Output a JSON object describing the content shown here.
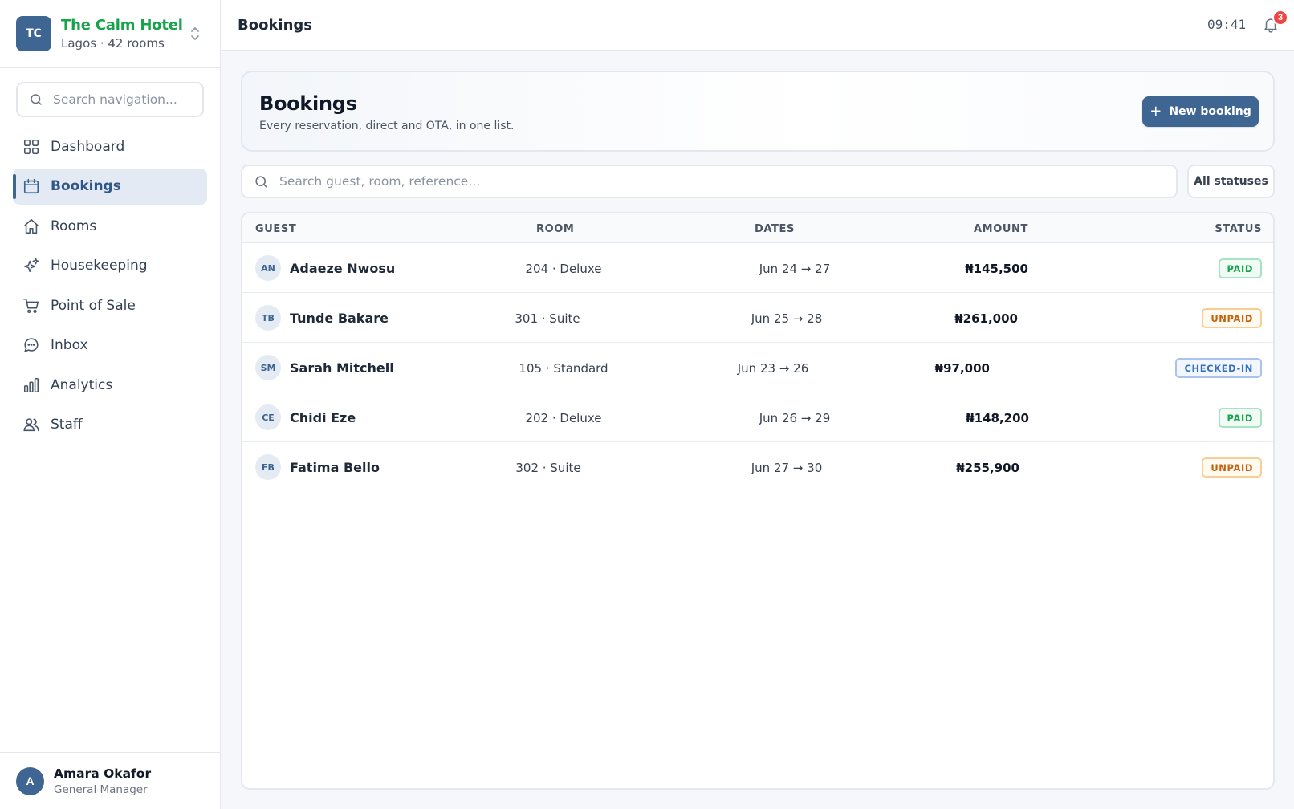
{
  "hotel": {
    "initials": "TC",
    "name": "The Calm Hotel",
    "meta": "Lagos · 42 rooms"
  },
  "sidebar": {
    "search_placeholder": "Search navigation...",
    "items": [
      {
        "label": "Dashboard",
        "icon": "grid-icon"
      },
      {
        "label": "Bookings",
        "icon": "calendar-icon",
        "active": true
      },
      {
        "label": "Rooms",
        "icon": "home-icon"
      },
      {
        "label": "Housekeeping",
        "icon": "sparkles-icon"
      },
      {
        "label": "Point of Sale",
        "icon": "cart-icon"
      },
      {
        "label": "Inbox",
        "icon": "chat-icon"
      },
      {
        "label": "Analytics",
        "icon": "bar-chart-icon"
      },
      {
        "label": "Staff",
        "icon": "users-icon"
      }
    ]
  },
  "user": {
    "initial": "A",
    "name": "Amara Okafor",
    "role": "General Manager"
  },
  "topbar": {
    "title": "Bookings",
    "clock": "09:41",
    "notification_count": "3"
  },
  "hero": {
    "title": "Bookings",
    "subtitle": "Every reservation, direct and OTA, in one list.",
    "new_button": "New booking"
  },
  "filters": {
    "search_placeholder": "Search guest, room, reference...",
    "status_filter": "All statuses"
  },
  "table": {
    "headers": {
      "guest": "GUEST",
      "room": "ROOM",
      "dates": "DATES",
      "amount": "AMOUNT",
      "status": "STATUS"
    },
    "rows": [
      {
        "initials": "AN",
        "guest": "Adaeze Nwosu",
        "room": "204 · Deluxe",
        "dates": "Jun 24 → 27",
        "amount": "₦145,500",
        "status": "PAID",
        "status_kind": "paid"
      },
      {
        "initials": "TB",
        "guest": "Tunde Bakare",
        "room": "301 · Suite",
        "dates": "Jun 25 → 28",
        "amount": "₦261,000",
        "status": "UNPAID",
        "status_kind": "unpaid"
      },
      {
        "initials": "SM",
        "guest": "Sarah Mitchell",
        "room": "105 · Standard",
        "dates": "Jun 23 → 26",
        "amount": "₦97,000",
        "status": "CHECKED-IN",
        "status_kind": "checked"
      },
      {
        "initials": "CE",
        "guest": "Chidi Eze",
        "room": "202 · Deluxe",
        "dates": "Jun 26 → 29",
        "amount": "₦148,200",
        "status": "PAID",
        "status_kind": "paid"
      },
      {
        "initials": "FB",
        "guest": "Fatima Bello",
        "room": "302 · Suite",
        "dates": "Jun 27 → 30",
        "amount": "₦255,900",
        "status": "UNPAID",
        "status_kind": "unpaid"
      }
    ]
  },
  "colors": {
    "accent": "#3f6593",
    "hotel_name": "#16a34a",
    "badge_paid": "#16a34a",
    "badge_unpaid": "#c2620c",
    "badge_checked": "#3470c4",
    "notification": "#ef4444"
  }
}
